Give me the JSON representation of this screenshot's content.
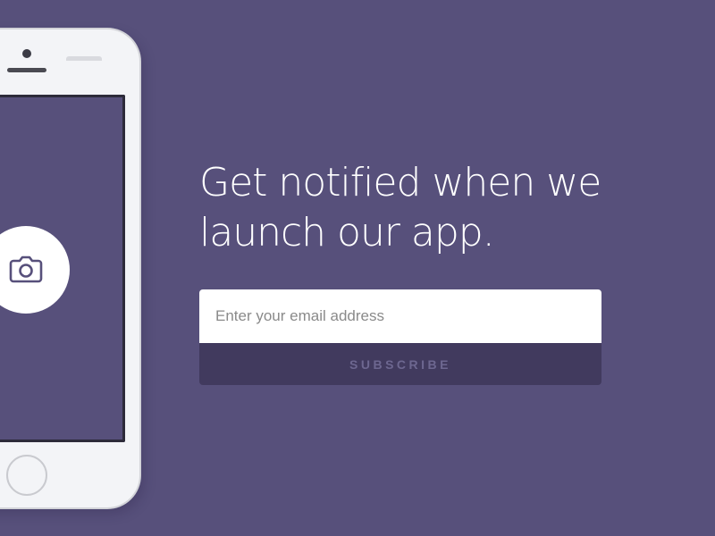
{
  "headline": {
    "line1": "Get notified when we",
    "line2": "launch our app."
  },
  "signup": {
    "email_placeholder": "Enter your email address",
    "subscribe_label": "SUBSCRIBE"
  },
  "phone": {
    "screen_icon": "camera-icon"
  },
  "colors": {
    "background": "#57507b",
    "button": "#413a5e",
    "button_text": "#6d6790",
    "input_bg": "#ffffff",
    "phone_body": "#f3f4f7"
  }
}
